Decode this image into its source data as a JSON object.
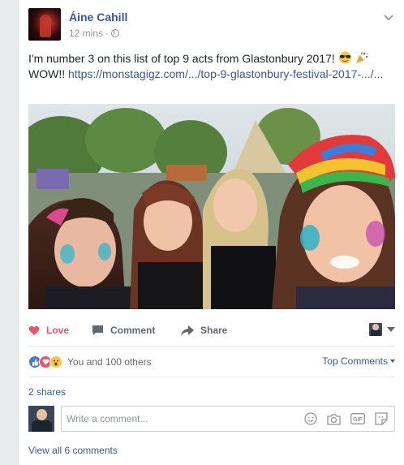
{
  "post": {
    "author": "Áine Cahill",
    "time": "12 mins",
    "separator": "·",
    "text_line1": "I'm number 3 on this list of top 9 acts from Glastonbury 2017!",
    "text_line2_prefix": "WOW!!",
    "link_text": "https://monstagigz.com/.../top-9-glastonbury-festival-2017-.../...",
    "emojis": [
      "sunglasses-emoji",
      "party-popper-emoji"
    ]
  },
  "actions": {
    "love_label": "Love",
    "comment_label": "Comment",
    "share_label": "Share"
  },
  "reactions": {
    "types": [
      "like",
      "love",
      "wow"
    ],
    "summary": "You and 100 others",
    "top_comments_label": "Top Comments"
  },
  "shares": {
    "label": "2 shares"
  },
  "comment_box": {
    "placeholder": "Write a comment..."
  },
  "comments": {
    "view_all_label": "View all 6 comments"
  },
  "colors": {
    "link": "#365899",
    "love": "#f25268",
    "muted": "#90949c",
    "action": "#606770"
  }
}
